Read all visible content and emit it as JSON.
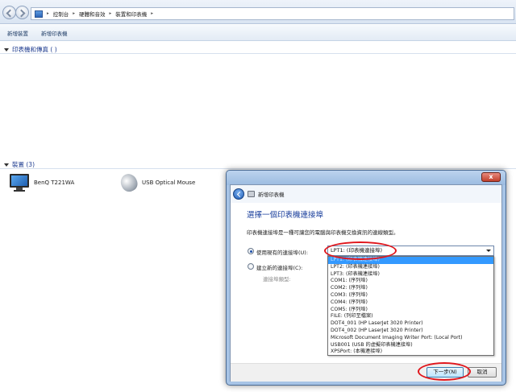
{
  "explorer": {
    "breadcrumbs": [
      "控制台",
      "硬體和音效",
      "裝置和印表機"
    ],
    "commands": [
      "新增裝置",
      "新增印表機"
    ],
    "printers_section": "印表機和傳真 (   )",
    "devices_section": "裝置 (3)",
    "devices": [
      {
        "name": "BenQ T221WA",
        "icon": "monitor-icon"
      },
      {
        "name": "USB Optical Mouse",
        "icon": "mouse-icon"
      }
    ]
  },
  "dialog": {
    "title": "新增印表機",
    "close": "x",
    "heading": "選擇一個印表機連接埠",
    "description": "印表機連接埠是一種可讓您的電腦與印表機交換資訊的連線類型。",
    "use_existing_label": "使用現有的連接埠(U):",
    "create_new_label": "建立新的連接埠(C):",
    "port_type_label": "連接埠類型:",
    "selected_port": "LPT1: (印表機連接埠)",
    "port_options": [
      "LPT1: (印表機連接埠)",
      "LPT2: (印表機連接埠)",
      "LPT3: (印表機連接埠)",
      "COM1: (序列埠)",
      "COM2: (序列埠)",
      "COM3: (序列埠)",
      "COM4: (序列埠)",
      "COM5: (序列埠)",
      "FILE: (列印至檔案)",
      "DOT4_001 (HP LaserJet 3020 Printer)",
      "DOT4_002 (HP LaserJet 3020 Printer)",
      "Microsoft Document Imaging Writer Port: (Local Port)",
      "USB001 (USB 的虛擬印表機連接埠)",
      "XPSPort: (本機連接埠)"
    ],
    "next_button": "下一步(N)",
    "cancel_button": "取消"
  },
  "colors": {
    "highlight": "#e0161c",
    "selection": "#3399ff",
    "heading": "#1a3f9c"
  }
}
